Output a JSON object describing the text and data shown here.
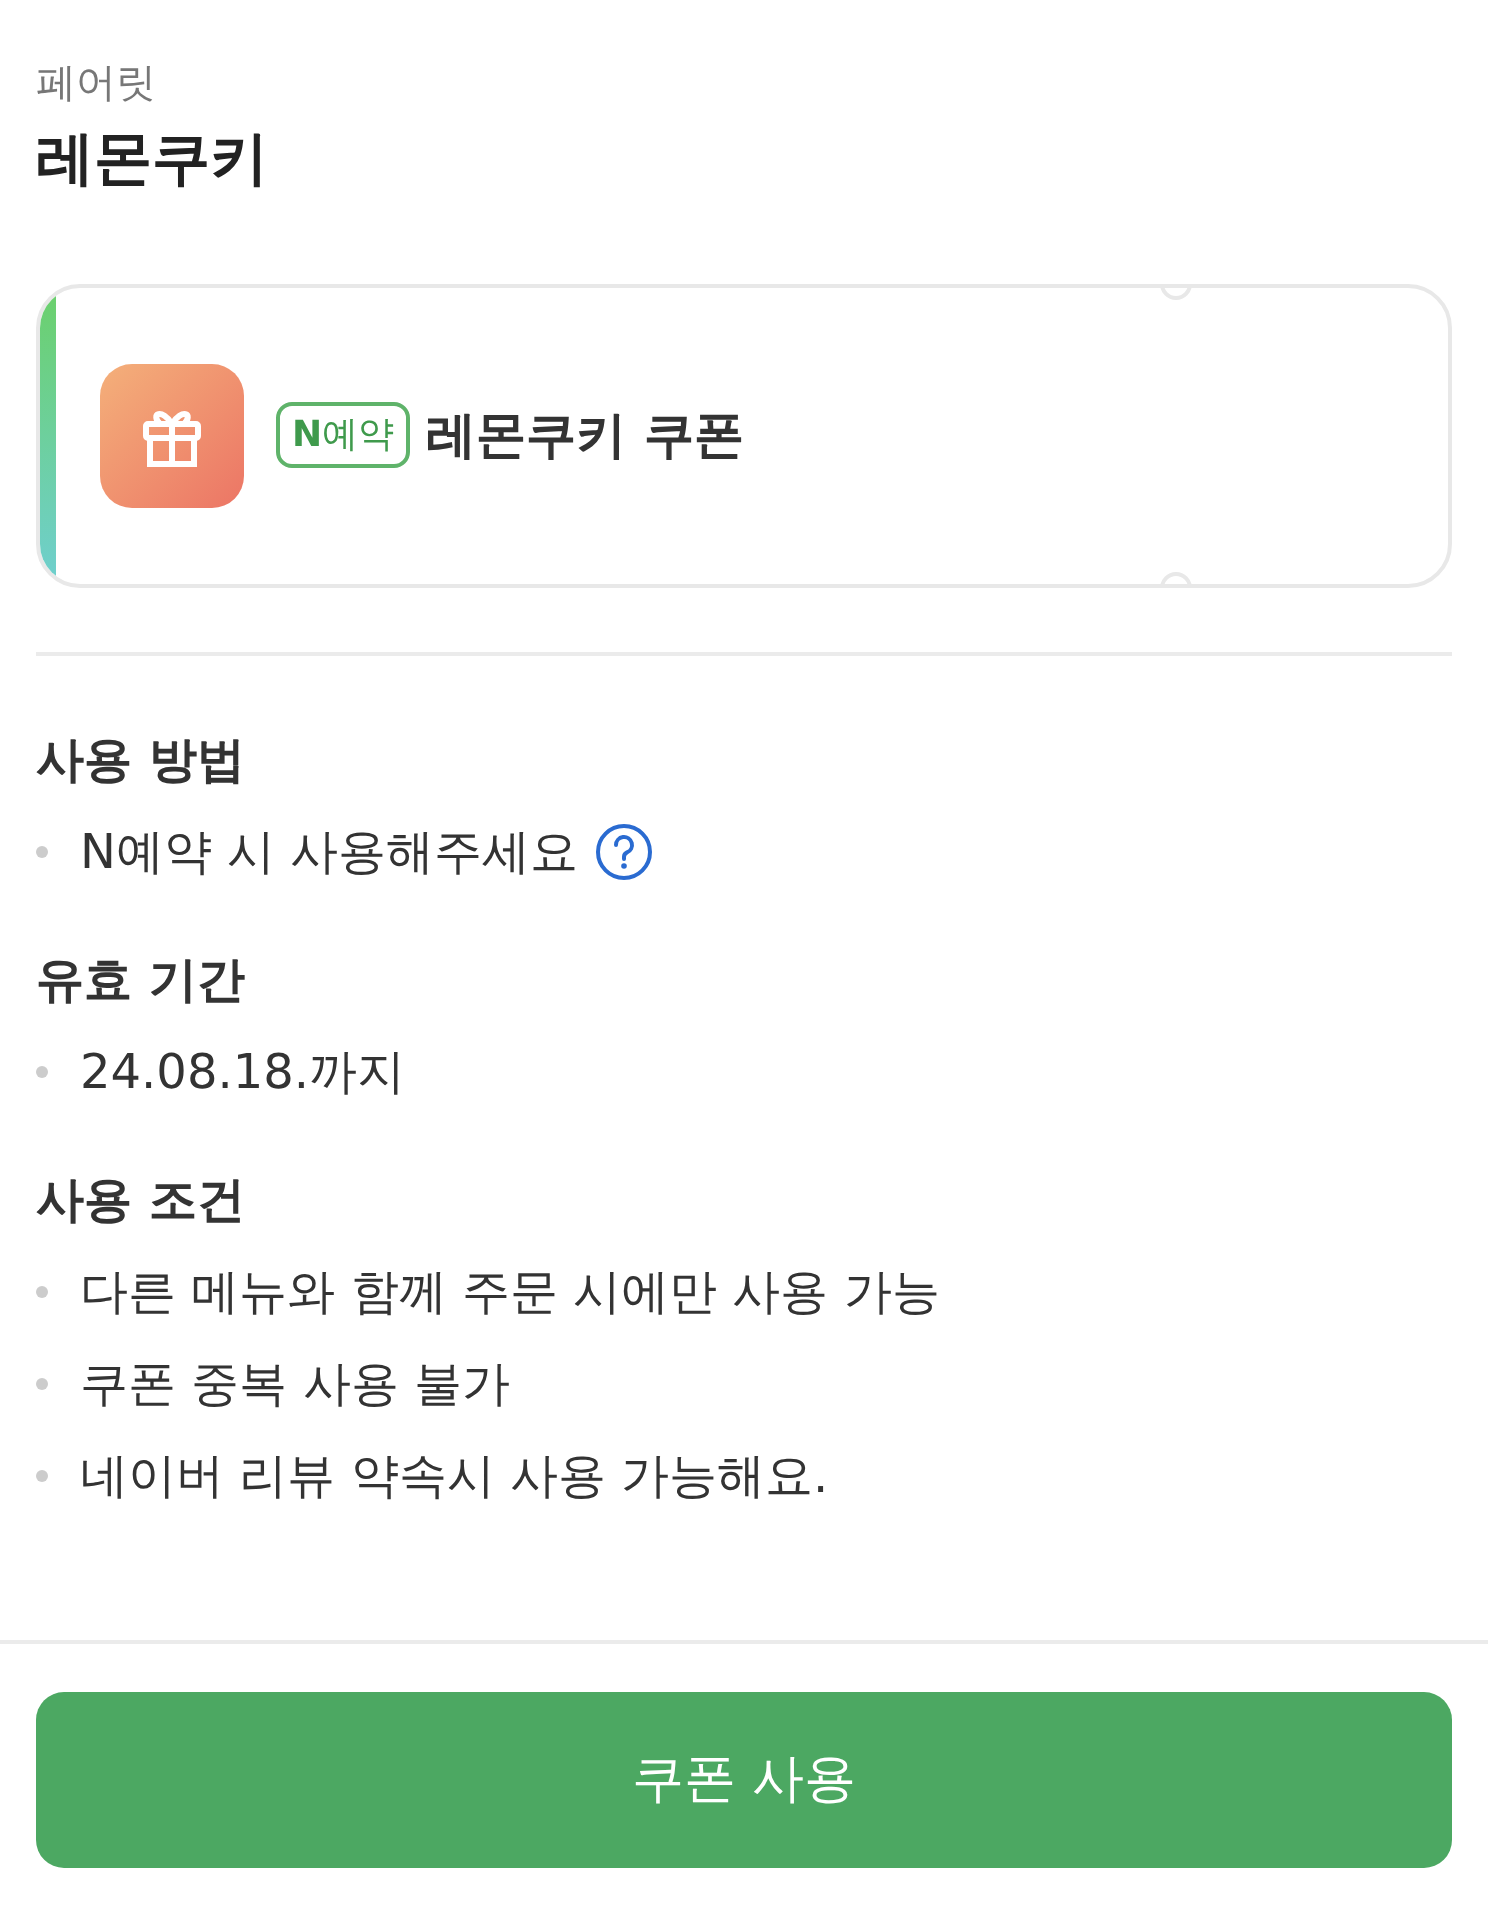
{
  "store": {
    "name": "페어릿",
    "title": "레몬쿠키"
  },
  "coupon": {
    "badge": "**N**예약",
    "name": "레몬쿠키 쿠폰"
  },
  "sections": [
    {
      "title": "사용 방법",
      "items": [
        {
          "text": "N예약 시 사용해주세요",
          "help": true
        }
      ]
    },
    {
      "title": "유효 기간",
      "items": [
        {
          "text": "24.08.18.까지",
          "help": false
        }
      ]
    },
    {
      "title": "사용 조건",
      "items": [
        {
          "text": "다른 메뉴와 함께 주문 시에만 사용 가능",
          "help": false
        },
        {
          "text": "쿠폰 중복 사용 불가",
          "help": false
        },
        {
          "text": "네이버 리뷰 약속시 사용 가능해요.",
          "help": false
        }
      ]
    }
  ],
  "button": "쿠폰 사용"
}
